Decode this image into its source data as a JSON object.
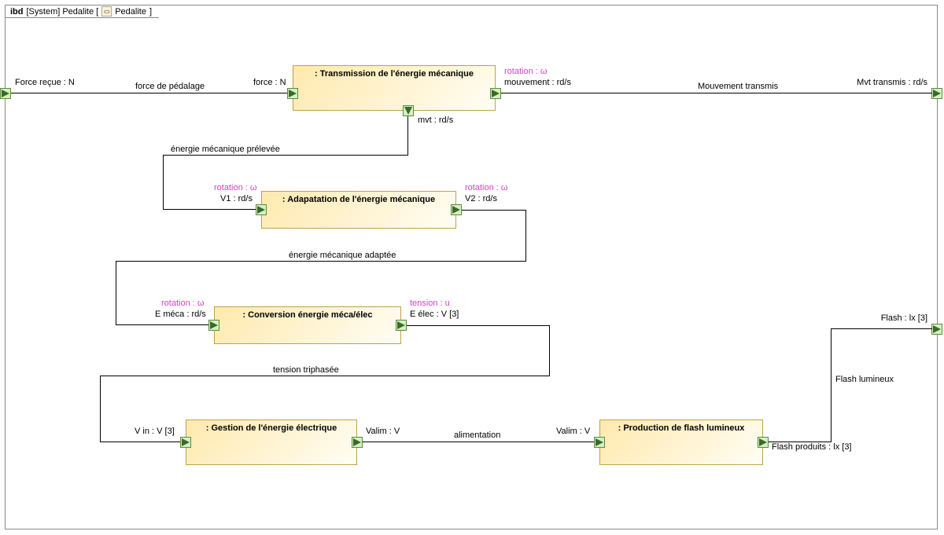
{
  "frame": {
    "prefix": "ibd",
    "context": "[System] Pedalite [",
    "name": "Pedalite",
    "suffix": "]"
  },
  "ports": {
    "left_in": {
      "label": "Force reçue : N"
    },
    "right_out_top": {
      "label": "Mvt transmis : rd/s"
    },
    "right_out_bottom": {
      "label": "Flash : lx [3]"
    }
  },
  "blocks": {
    "transmission": {
      "title": ": Transmission de l'énergie mécanique",
      "port_left": "force : N",
      "port_right": "mouvement : rd/s",
      "port_bottom": "mvt : rd/s",
      "stereo_right": "rotation : ω"
    },
    "adaptation": {
      "title": ": Adapatation de l'énergie mécanique",
      "port_left": "V1 : rd/s",
      "port_right": "V2 : rd/s",
      "stereo_left": "rotation : ω",
      "stereo_right": "rotation : ω"
    },
    "conversion": {
      "title": ": Conversion énergie méca/élec",
      "port_left": "E méca : rd/s",
      "port_right": "E élec : V [3]",
      "stereo_left": "rotation : ω",
      "stereo_right": "tension : u"
    },
    "gestion": {
      "title": ": Gestion de l'énergie électrique",
      "port_left": "V in : V [3]",
      "port_right": "Valim : V"
    },
    "production": {
      "title": ": Production de flash lumineux",
      "port_left": "Valim : V",
      "port_right": "Flash produits : lx [3]"
    }
  },
  "connectors": {
    "c1": "force de pédalage",
    "c2": "Mouvement transmis",
    "c3": "énergie mécanique prélevée",
    "c4": "énergie mécanique adaptée",
    "c5": "tension triphasée",
    "c6": "alimentation",
    "c7": "Flash lumineux"
  }
}
